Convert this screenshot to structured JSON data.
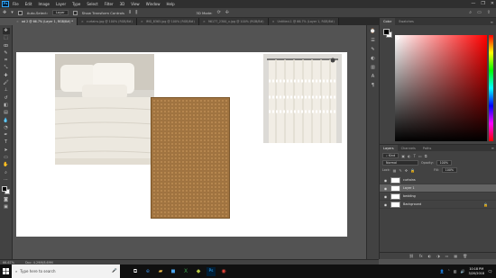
{
  "app": {
    "logo_text": "Ps",
    "menu": [
      "File",
      "Edit",
      "Image",
      "Layer",
      "Type",
      "Select",
      "Filter",
      "3D",
      "View",
      "Window",
      "Help"
    ],
    "window_controls": [
      "—",
      "❐",
      "✕"
    ]
  },
  "options_bar": {
    "auto_select_label": "Auto-Select:",
    "auto_select_value": "Layer",
    "transform_label": "Show Transform Controls",
    "mode_label": "3D Mode:"
  },
  "tabs": [
    {
      "label": "ad 2 @ 66.7% (Layer 1, RGB/8#) *",
      "active": true
    },
    {
      "label": "curtains.jpg @ 100% (RGB/8#)",
      "active": false
    },
    {
      "label": "IMG_8365.jpg @ 100% (RGB/8#)",
      "active": false
    },
    {
      "label": "96177_2300_x.jpg @ 100% (RGB/8#)",
      "active": false
    },
    {
      "label": "Untitled-1 @ 66.7% (Layer 1, RGB/8#)",
      "active": false
    }
  ],
  "status": {
    "zoom": "66.67%",
    "doc_size": "Doc: 4.29M/8.69M"
  },
  "color_panel": {
    "tabs": [
      "Color",
      "Swatches"
    ]
  },
  "layers_panel": {
    "tabs": [
      "Layers",
      "Channels",
      "Paths"
    ],
    "kind_filter": "Kind",
    "blend_mode": "Normal",
    "opacity_label": "Opacity:",
    "opacity_value": "100%",
    "lock_label": "Lock:",
    "fill_label": "Fill:",
    "fill_value": "100%",
    "layers": [
      {
        "name": "curtains",
        "selected": false,
        "locked": false
      },
      {
        "name": "Layer 1",
        "selected": true,
        "locked": false
      },
      {
        "name": "bedding",
        "selected": false,
        "locked": false
      },
      {
        "name": "Background",
        "selected": false,
        "locked": true
      }
    ],
    "footer_icons": [
      "⛓",
      "fx",
      "◐",
      "◑",
      "▭",
      "▦",
      "🗑"
    ]
  },
  "taskbar": {
    "search_placeholder": "Type here to search",
    "time": "10:18 PM",
    "date": "3/20/2018"
  }
}
